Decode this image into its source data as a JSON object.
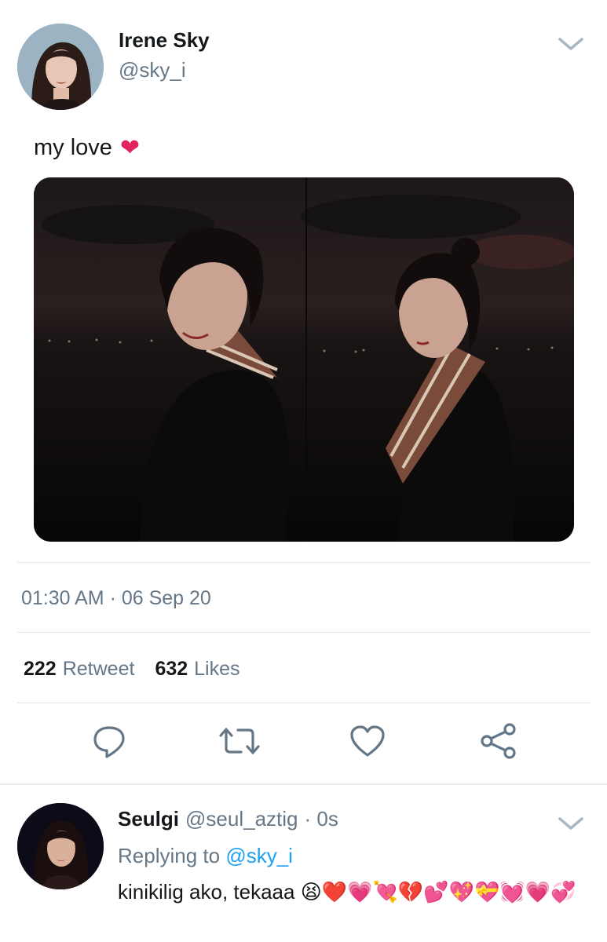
{
  "tweet": {
    "display_name": "Irene Sky",
    "handle": "@sky_i",
    "text": "my love",
    "text_emoji": "❤️",
    "timestamp": "01:30 AM · 06 Sep 20",
    "retweets_count": "222",
    "retweets_label": "Retweet",
    "likes_count": "632",
    "likes_label": "Likes"
  },
  "reply": {
    "display_name": "Seulgi",
    "handle": "@seul_aztig",
    "time": "· 0s",
    "replying_prefix": "Replying to",
    "replying_to": "@sky_i",
    "text": "kinikilig ako, tekaaa",
    "emojis": "😫❤️💗💘💔💕💖💝💓💗💞"
  },
  "icons": {
    "reply": "comment-icon",
    "retweet": "retweet-icon",
    "like": "heart-icon",
    "share": "share-icon",
    "menu": "chevron-down-icon"
  },
  "colors": {
    "text_primary": "#14171a",
    "text_secondary": "#657786",
    "link": "#1da1f2",
    "divider": "#e1e8ed",
    "heart": "#e0245e"
  }
}
